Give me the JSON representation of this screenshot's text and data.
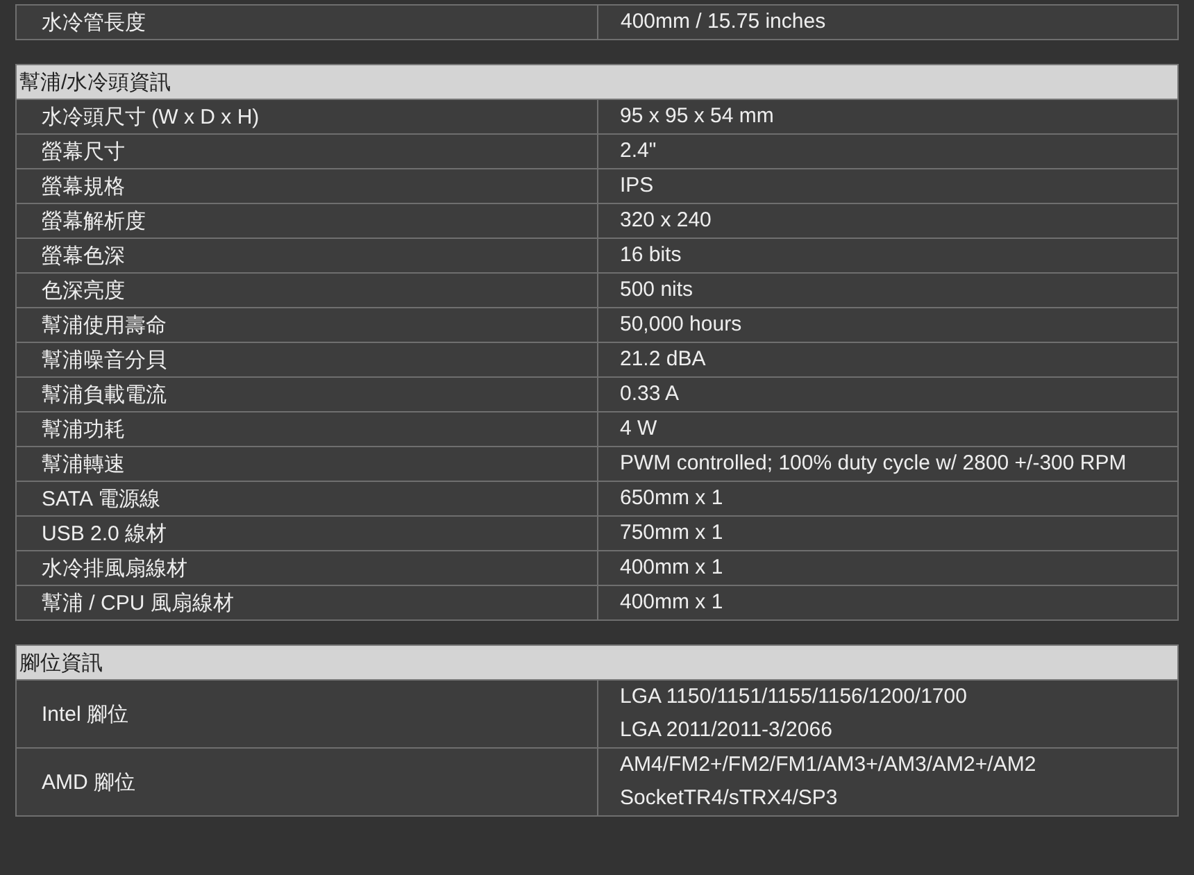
{
  "sections": [
    {
      "rows": [
        {
          "label": "水冷管長度",
          "lines": [
            "400mm / 15.75 inches"
          ]
        }
      ]
    },
    {
      "title": "幫浦/水冷頭資訊",
      "rows": [
        {
          "label": "水冷頭尺寸 (W x D x H)",
          "lines": [
            "95 x 95 x 54 mm"
          ]
        },
        {
          "label": "螢幕尺寸",
          "lines": [
            "2.4\""
          ]
        },
        {
          "label": "螢幕規格",
          "lines": [
            "IPS"
          ]
        },
        {
          "label": "螢幕解析度",
          "lines": [
            "320 x 240"
          ]
        },
        {
          "label": "螢幕色深",
          "lines": [
            "16 bits"
          ]
        },
        {
          "label": "色深亮度",
          "lines": [
            "500 nits"
          ]
        },
        {
          "label": "幫浦使用壽命",
          "lines": [
            "50,000 hours"
          ]
        },
        {
          "label": "幫浦噪音分貝",
          "lines": [
            "21.2 dBA"
          ]
        },
        {
          "label": "幫浦負載電流",
          "lines": [
            "0.33 A"
          ]
        },
        {
          "label": "幫浦功耗",
          "lines": [
            "4 W"
          ]
        },
        {
          "label": "幫浦轉速",
          "lines": [
            "PWM controlled; 100% duty cycle w/ 2800 +/-300 RPM"
          ]
        },
        {
          "label": "SATA 電源線",
          "lines": [
            "650mm x 1"
          ]
        },
        {
          "label": "USB 2.0 線材",
          "lines": [
            "750mm x 1"
          ]
        },
        {
          "label": "水冷排風扇線材",
          "lines": [
            "400mm x 1"
          ]
        },
        {
          "label": "幫浦 / CPU 風扇線材",
          "lines": [
            "400mm x 1"
          ]
        }
      ]
    },
    {
      "title": "腳位資訊",
      "rows": [
        {
          "label": "Intel 腳位",
          "lines": [
            "LGA 1150/1151/1155/1156/1200/1700",
            "LGA 2011/2011-3/2066"
          ]
        },
        {
          "label": "AMD 腳位",
          "lines": [
            "AM4/FM2+/FM2/FM1/AM3+/AM3/AM2+/AM2",
            "SocketTR4/sTRX4/SP3"
          ]
        }
      ]
    }
  ]
}
